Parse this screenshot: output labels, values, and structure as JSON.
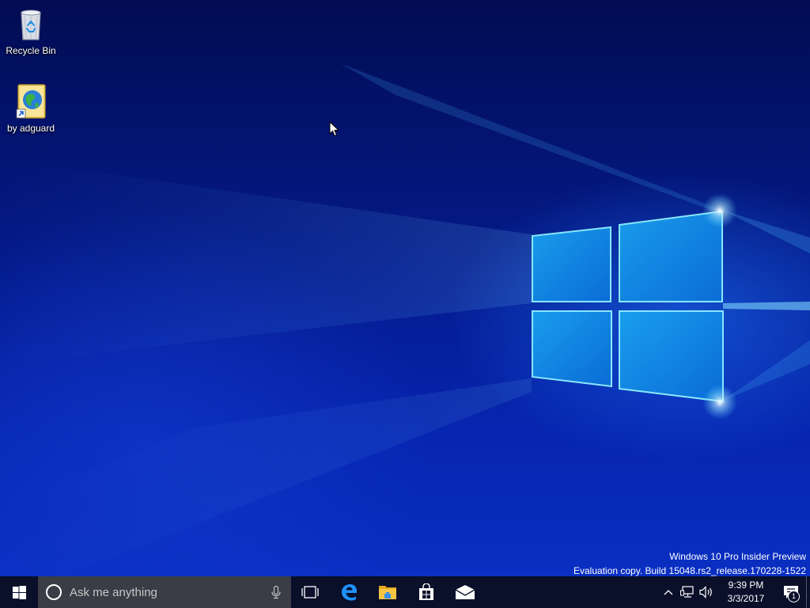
{
  "desktop": {
    "icons": [
      {
        "label": "Recycle Bin",
        "icon": "recycle-bin-icon"
      },
      {
        "label": "by adguard",
        "icon": "globe-book-shortcut-icon"
      }
    ],
    "watermark": {
      "line1": "Windows 10 Pro Insider Preview",
      "line2": "Evaluation copy. Build 15048.rs2_release.170228-1522"
    },
    "wallpaper_colors": {
      "deep": "#020c52",
      "mid": "#0625b0",
      "glow": "#5ad8ff"
    }
  },
  "taskbar": {
    "background": "#0a0f2a",
    "start_icon": "windows-logo-icon",
    "search": {
      "placeholder": "Ask me anything",
      "icon": "cortana-icon",
      "mic_icon": "microphone-icon"
    },
    "task_view_icon": "task-view-icon",
    "pinned": [
      {
        "name": "Microsoft Edge",
        "icon": "edge-icon",
        "color": "#1e90ff"
      },
      {
        "name": "File Explorer",
        "icon": "folder-icon",
        "color": "#f4c542"
      },
      {
        "name": "Store",
        "icon": "store-icon",
        "color": "#ffffff"
      },
      {
        "name": "Mail",
        "icon": "mail-icon",
        "color": "#ffffff"
      }
    ],
    "tray": {
      "chevron_icon": "chevron-up-icon",
      "network_icon": "network-icon",
      "volume_icon": "volume-icon",
      "time": "9:39 PM",
      "date": "3/3/2017",
      "notification_icon": "action-center-icon",
      "notification_count": "1"
    }
  }
}
